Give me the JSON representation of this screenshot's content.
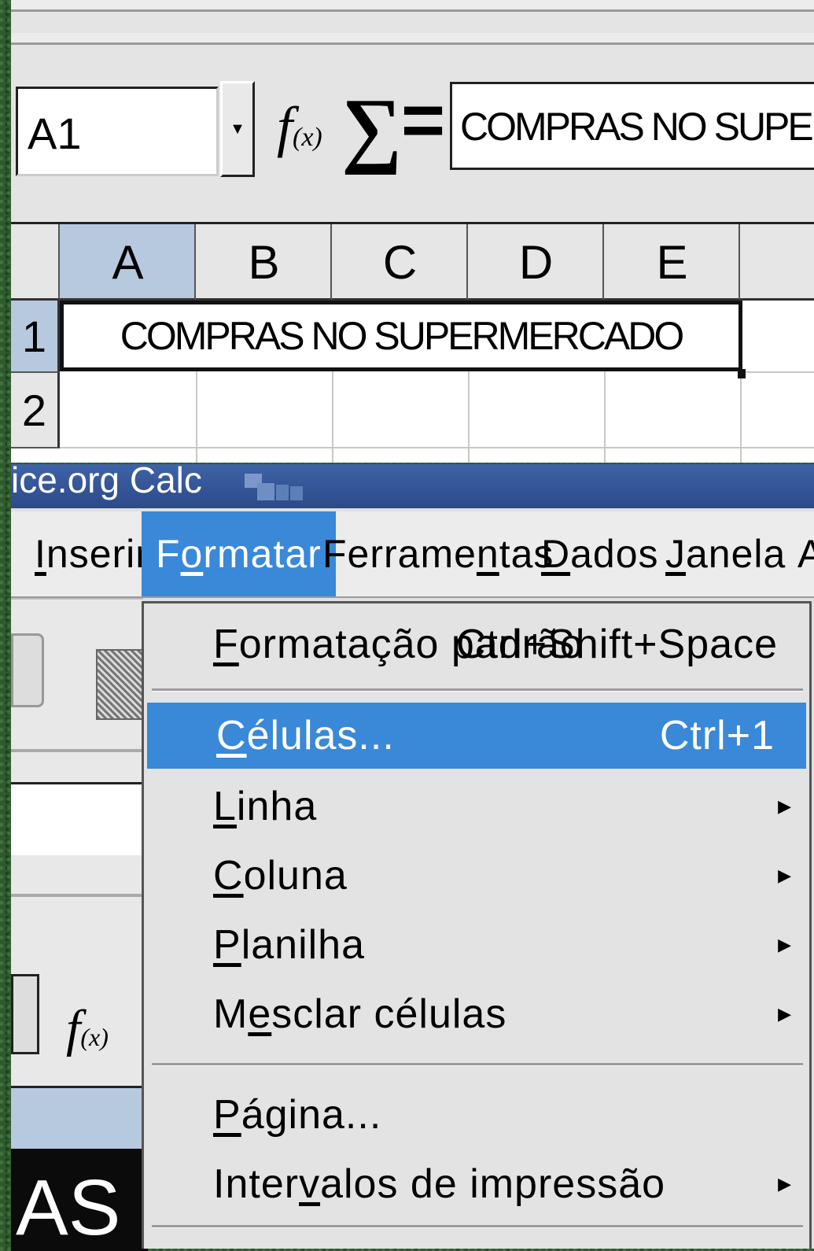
{
  "formula_bar": {
    "name_box": "A1",
    "formula_text": "COMPRAS  NO SUPERMERCADO"
  },
  "sheet": {
    "columns": [
      "A",
      "B",
      "C",
      "D",
      "E"
    ],
    "rows": [
      "1",
      "2"
    ],
    "merged_cell_text": "COMPRAS  NO SUPERMERCADO"
  },
  "window": {
    "title": "ice.org Calc"
  },
  "menubar": {
    "inserir": {
      "pre": "",
      "u": "I",
      "post": "nserir"
    },
    "formatar": {
      "pre": "F",
      "u": "o",
      "post": "rmatar"
    },
    "ferramentas": {
      "pre": "Ferrame",
      "u": "n",
      "post": "tas"
    },
    "dados": {
      "pre": "",
      "u": "D",
      "post": "ados"
    },
    "janela": {
      "pre": "",
      "u": "J",
      "post": "anela"
    },
    "cut": "A"
  },
  "format_menu": {
    "items": [
      {
        "pre": "",
        "u": "F",
        "post": "ormatação padrão",
        "shortcut": "Ctrl+Shift+Space"
      },
      {
        "pre": "",
        "u": "C",
        "post": "élulas...",
        "shortcut": "Ctrl+1"
      },
      {
        "pre": "",
        "u": "L",
        "post": "inha"
      },
      {
        "pre": "",
        "u": "C",
        "post": "oluna"
      },
      {
        "pre": "",
        "u": "P",
        "post": "lanilha"
      },
      {
        "pre": "M",
        "u": "e",
        "post": "sclar células"
      },
      {
        "pre": "",
        "u": "P",
        "post": "ágina..."
      },
      {
        "pre": "Inter",
        "u": "v",
        "post": "alos de impressão"
      }
    ]
  },
  "background_partial_text": "AS"
}
